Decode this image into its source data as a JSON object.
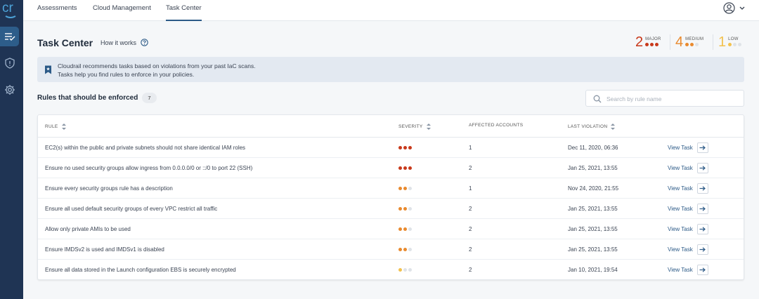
{
  "app": {
    "logo_text": "cr"
  },
  "nav": {
    "tabs": [
      {
        "label": "Assessments"
      },
      {
        "label": "Cloud Management"
      },
      {
        "label": "Task Center"
      }
    ]
  },
  "header": {
    "title": "Task Center",
    "how_it_works": "How it works"
  },
  "severity_summary": {
    "major": {
      "count": "2",
      "label": "MAJOR",
      "color": "#c8391b"
    },
    "medium": {
      "count": "4",
      "label": "MEDIUM",
      "color": "#e98a2e"
    },
    "low": {
      "count": "1",
      "label": "LOW",
      "color": "#f2c14e"
    }
  },
  "banner": {
    "line1": "Cloudrail recommends tasks based on violations from your past IaC scans.",
    "line2": "Tasks help you find rules to enforce in your policies."
  },
  "rules": {
    "title": "Rules that should be enforced",
    "count": "7",
    "search_placeholder": "Search by rule name"
  },
  "table": {
    "columns": {
      "rule": "RULE",
      "severity": "SEVERITY",
      "accounts": "AFFECTED ACCOUNTS",
      "last": "LAST VIOLATION"
    },
    "view_label": "View Task",
    "rows": [
      {
        "rule": "EC2(s) within the public and private subnets should not share identical IAM roles",
        "severity": "major",
        "accounts": "1",
        "last": "Dec 11, 2020, 06:36"
      },
      {
        "rule": "Ensure no used security groups allow ingress from 0.0.0.0/0 or ::/0 to port 22 (SSH)",
        "severity": "major",
        "accounts": "2",
        "last": "Jan 25, 2021, 13:55"
      },
      {
        "rule": "Ensure every security groups rule has a description",
        "severity": "medium",
        "accounts": "1",
        "last": "Nov 24, 2020, 21:55"
      },
      {
        "rule": "Ensure all used default security groups of every VPC restrict all traffic",
        "severity": "medium",
        "accounts": "2",
        "last": "Jan 25, 2021, 13:55"
      },
      {
        "rule": "Allow only private AMIs to be used",
        "severity": "medium",
        "accounts": "2",
        "last": "Jan 25, 2021, 13:55"
      },
      {
        "rule": "Ensure IMDSv2 is used and IMDSv1 is disabled",
        "severity": "medium",
        "accounts": "2",
        "last": "Jan 25, 2021, 13:55"
      },
      {
        "rule": "Ensure all data stored in the Launch configuration EBS is securely encrypted",
        "severity": "low",
        "accounts": "2",
        "last": "Jan 10, 2021, 19:54"
      }
    ]
  },
  "colors": {
    "sidebar": "#1f3454",
    "accent": "#2c5a87",
    "dot_empty": "#dfe3e8"
  },
  "icons": {
    "sidebar": [
      "task-list-check-icon",
      "shield-icon",
      "gear-icon"
    ],
    "user": "user-circle-icon",
    "chevron": "chevron-down-icon",
    "help": "question-circle-icon",
    "bookmark": "bookmark-star-icon",
    "search": "search-icon",
    "arrow": "arrow-right-icon"
  }
}
